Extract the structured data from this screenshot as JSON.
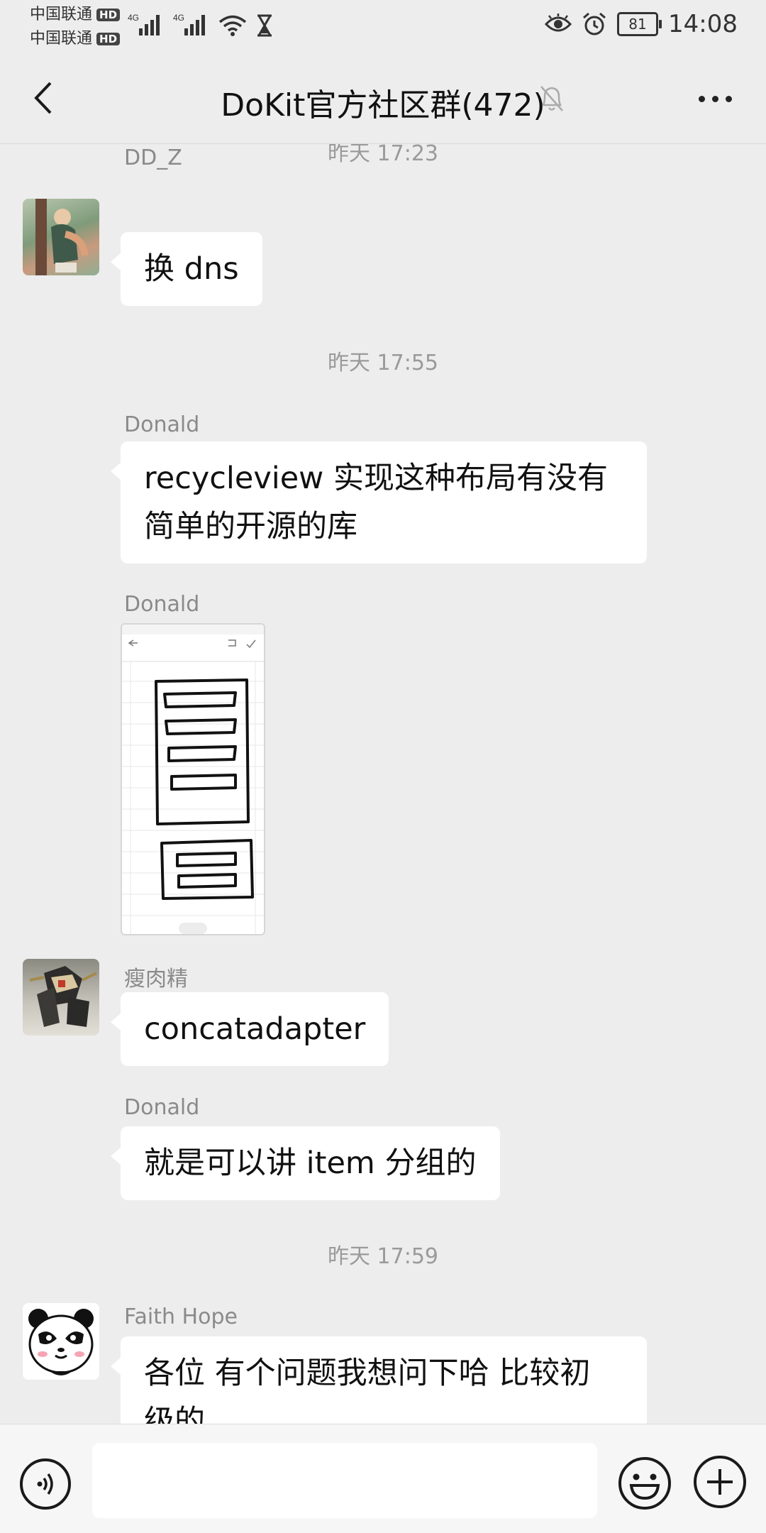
{
  "status_bar": {
    "carrier_1": "中国联通",
    "carrier_2": "中国联通",
    "hd_badge": "HD",
    "network_type": "4G",
    "battery": "81",
    "time": "14:08",
    "icons": [
      "signal-icon",
      "wifi-icon",
      "hourglass-icon",
      "eye-icon",
      "alarm-icon",
      "battery-icon"
    ]
  },
  "nav": {
    "title": "DoKit官方社区群(472)",
    "muted": true
  },
  "messages": [
    {
      "type": "time",
      "text": "昨天 17:23"
    },
    {
      "type": "text",
      "sender": "DD_Z",
      "avatar": "character-illustration",
      "text": "换 dns"
    },
    {
      "type": "time",
      "text": "昨天 17:55"
    },
    {
      "type": "text",
      "sender": "Donald",
      "text_line1": "recycleview 实现这种布局有没有",
      "text_line2": "简单的开源的库"
    },
    {
      "type": "image",
      "sender": "Donald",
      "image": "hand-drawn-list-layout-sketch"
    },
    {
      "type": "text",
      "sender": "瘦肉精",
      "avatar": "robot-figure-photo",
      "text": "concatadapter"
    },
    {
      "type": "text",
      "sender": "Donald",
      "text": "就是可以讲 item 分组的"
    },
    {
      "type": "time",
      "text": "昨天 17:59"
    },
    {
      "type": "text",
      "sender": "Faith Hope",
      "avatar": "panda-cartoon",
      "text_line1": "各位  有个问题我想问下哈 比较初",
      "text_line2": "级的"
    }
  ],
  "input_bar": {
    "placeholder": "",
    "icons": [
      "voice-icon",
      "emoji-icon",
      "plus-icon"
    ]
  },
  "colors": {
    "background": "#ededed",
    "bubble": "#ffffff",
    "muted_text": "#9a9a9a"
  }
}
